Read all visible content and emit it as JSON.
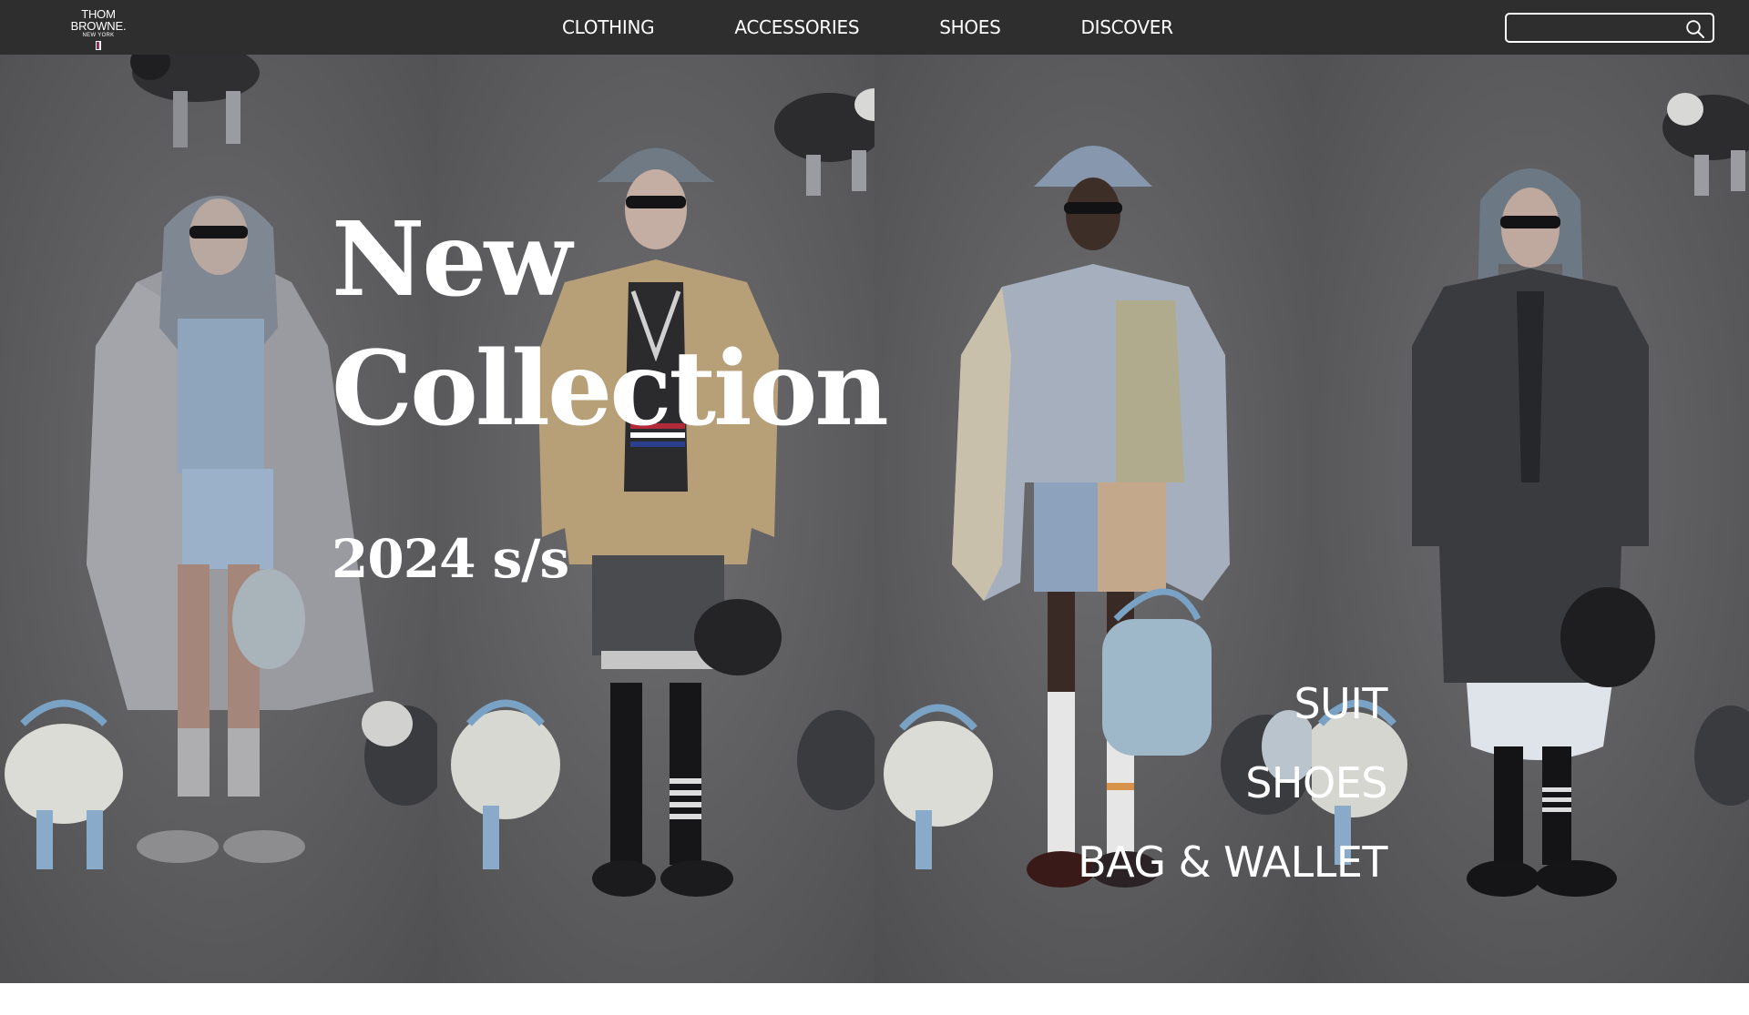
{
  "brand": {
    "name": "THOM BROWNE.",
    "city": "NEW YORK"
  },
  "nav": {
    "items": [
      {
        "label": "CLOTHING"
      },
      {
        "label": "ACCESSORIES"
      },
      {
        "label": "SHOES"
      },
      {
        "label": "DISCOVER"
      }
    ]
  },
  "search": {
    "value": "",
    "placeholder": "",
    "icon": "search-icon"
  },
  "hero": {
    "title_line1": "New",
    "title_line2": "Collection",
    "subtitle": "2024 s/s",
    "categories": [
      {
        "label": "SUIT"
      },
      {
        "label": "SHOES"
      },
      {
        "label": "BAG & WALLET"
      }
    ]
  },
  "colors": {
    "header_bg": "#2e2e2e",
    "backdrop": "#5b5b5d",
    "text": "#ffffff"
  }
}
